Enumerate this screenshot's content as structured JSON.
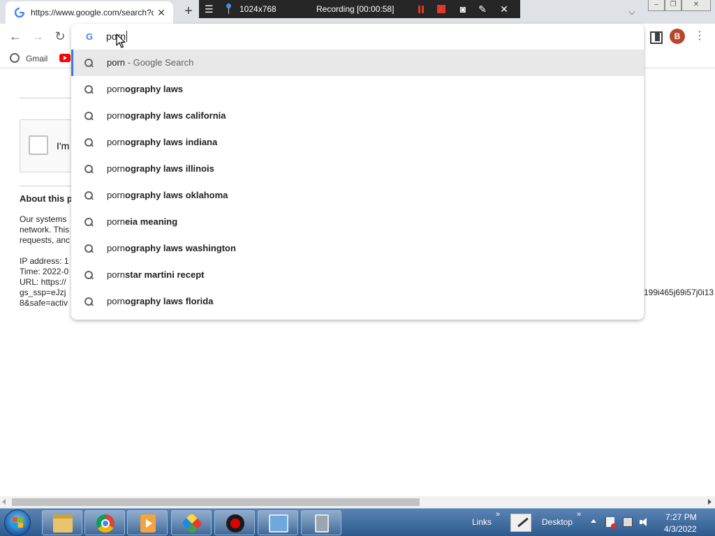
{
  "browser": {
    "tab": {
      "title": "https://www.google.com/search?q=porn",
      "favicon": "google-favicon",
      "close_icon": "close-icon"
    },
    "new_tab_icon": "plus-icon",
    "tab_search_icon": "chevron-down-icon",
    "window_controls": {
      "minimize": "minimize-icon",
      "maximize": "restore-icon",
      "close": "close-icon"
    },
    "toolbar": {
      "back_icon": "arrow-left-icon",
      "forward_icon": "arrow-right-icon",
      "reload_icon": "reload-icon",
      "side_panel_icon": "side-panel-icon",
      "profile_initial": "B",
      "menu_icon": "kebab-menu-icon"
    },
    "bookmarks": [
      {
        "label": "Gmail",
        "icon": "globe-icon"
      },
      {
        "label": "",
        "icon": "youtube-icon"
      }
    ]
  },
  "recorder": {
    "menu_icon": "hamburger-icon",
    "pin_icon": "pin-icon",
    "size": "1024x768",
    "status": "Recording [00:00:58]",
    "pause_icon": "pause-icon",
    "stop_icon": "stop-icon",
    "camera_icon": "camera-icon",
    "pen_icon": "pen-icon",
    "close_icon": "close-icon"
  },
  "omnibox": {
    "query": "porn",
    "icon": "google-g-icon",
    "suggestions": [
      {
        "typed": "porn",
        "completion": "",
        "suffix": " - Google Search"
      },
      {
        "typed": "porn",
        "completion": "ography laws",
        "suffix": ""
      },
      {
        "typed": "porn",
        "completion": "ography laws california",
        "suffix": ""
      },
      {
        "typed": "porn",
        "completion": "ography laws indiana",
        "suffix": ""
      },
      {
        "typed": "porn",
        "completion": "ography laws illinois",
        "suffix": ""
      },
      {
        "typed": "porn",
        "completion": "ography laws oklahoma",
        "suffix": ""
      },
      {
        "typed": "porn",
        "completion": "eia meaning",
        "suffix": ""
      },
      {
        "typed": "porn",
        "completion": "ography laws washington",
        "suffix": ""
      },
      {
        "typed": "porn",
        "completion": "star martini recept",
        "suffix": ""
      },
      {
        "typed": "porn",
        "completion": "ography laws florida",
        "suffix": ""
      }
    ]
  },
  "page": {
    "captcha_label": "I'm",
    "about_title": "About this p",
    "body_lines": [
      "Our systems",
      "network. This",
      "requests, anc"
    ],
    "ip_line": "IP address: 1",
    "time_line": "Time: 2022-0",
    "url_line": "URL: https://",
    "ssp_line": "gs_ssp=eJzj",
    "safe_line": "8&safe=activ",
    "url_tail": "199i465j69i57j0i13"
  },
  "taskbar": {
    "start_icon": "windows-start-icon",
    "pinned": [
      "file-explorer-icon",
      "chrome-icon",
      "media-player-icon",
      "paint-icon",
      "record-icon",
      "remote-desktop-icon",
      "server-icon"
    ],
    "links_label": "Links",
    "desktop_label": "Desktop",
    "chevron": "»",
    "tray": [
      "show-hidden-icons-icon",
      "action-center-flag-icon",
      "network-icon",
      "volume-icon"
    ],
    "time": "7:27 PM",
    "date": "4/3/2022"
  },
  "colors": {
    "selected_accent": "#3b78e7",
    "selected_row": "#e8e8e8",
    "profile": "#b7472a",
    "recording_red": "#e0382b"
  }
}
